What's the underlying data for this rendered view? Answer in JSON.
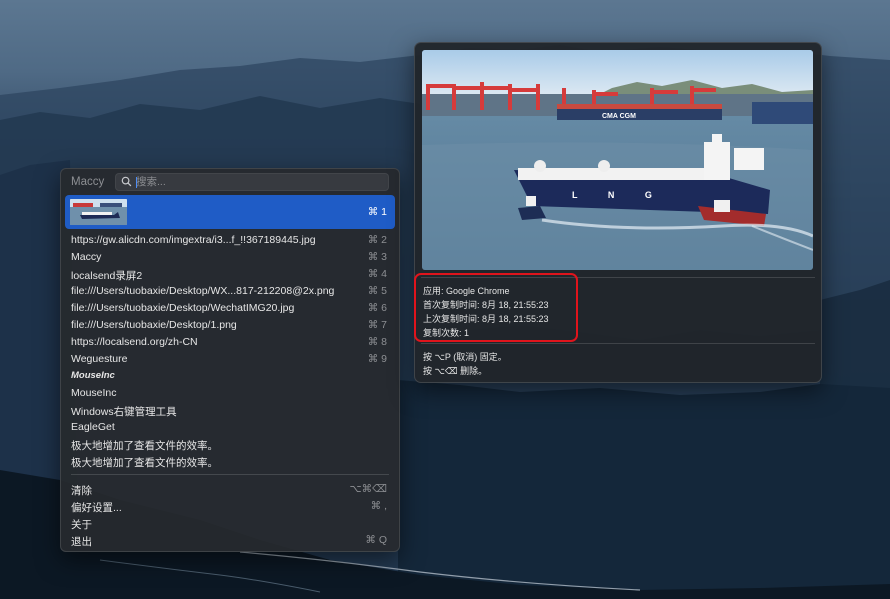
{
  "maccy": {
    "app_title": "Maccy",
    "search_placeholder": "搜索...",
    "selected_shortcut": "⌘ 1",
    "items": [
      {
        "label": "https://gw.alicdn.com/imgextra/i3...f_!!367189445.jpg",
        "shortcut": "⌘ 2"
      },
      {
        "label": "Maccy",
        "shortcut": "⌘ 3"
      },
      {
        "label": "localsend录屏2",
        "shortcut": "⌘ 4"
      },
      {
        "label": "file:///Users/tuobaxie/Desktop/WX...817-212208@2x.png",
        "shortcut": "⌘ 5"
      },
      {
        "label": "file:///Users/tuobaxie/Desktop/WechatIMG20.jpg",
        "shortcut": "⌘ 6"
      },
      {
        "label": "file:///Users/tuobaxie/Desktop/1.png",
        "shortcut": "⌘ 7"
      },
      {
        "label": "https://localsend.org/zh-CN",
        "shortcut": "⌘ 8"
      },
      {
        "label": "Weguesture",
        "shortcut": "⌘ 9"
      },
      {
        "label": "MouseInc",
        "shortcut": ""
      },
      {
        "label": "MouseInc",
        "shortcut": ""
      },
      {
        "label": "Windows右键管理工具",
        "shortcut": ""
      },
      {
        "label": "EagleGet",
        "shortcut": ""
      },
      {
        "label": "极大地增加了查看文件的效率。",
        "shortcut": ""
      },
      {
        "label": "极大地增加了查看文件的效率。",
        "shortcut": ""
      }
    ],
    "actions": [
      {
        "label": "清除",
        "shortcut": "⌥⌘⌫"
      },
      {
        "label": "偏好设置...",
        "shortcut": "⌘ ,"
      },
      {
        "label": "关于",
        "shortcut": ""
      },
      {
        "label": "退出",
        "shortcut": "⌘ Q"
      }
    ]
  },
  "preview": {
    "app_line": "应用: Google Chrome",
    "first_copy": "首次复制时间: 8月 18, 21:55:23",
    "last_copy": "上次复制时间: 8月 18, 21:55:23",
    "copy_count": "复制次数: 1",
    "hint_pin": "按 ⌥P (取消) 固定。",
    "hint_delete": "按 ⌥⌫ 删除。",
    "ship_text": "L N G",
    "container_text": "CMA CGM",
    "highlight_color": "#e0141c"
  },
  "colors": {
    "selection": "#1f5cc6",
    "panel": "#26292e"
  }
}
